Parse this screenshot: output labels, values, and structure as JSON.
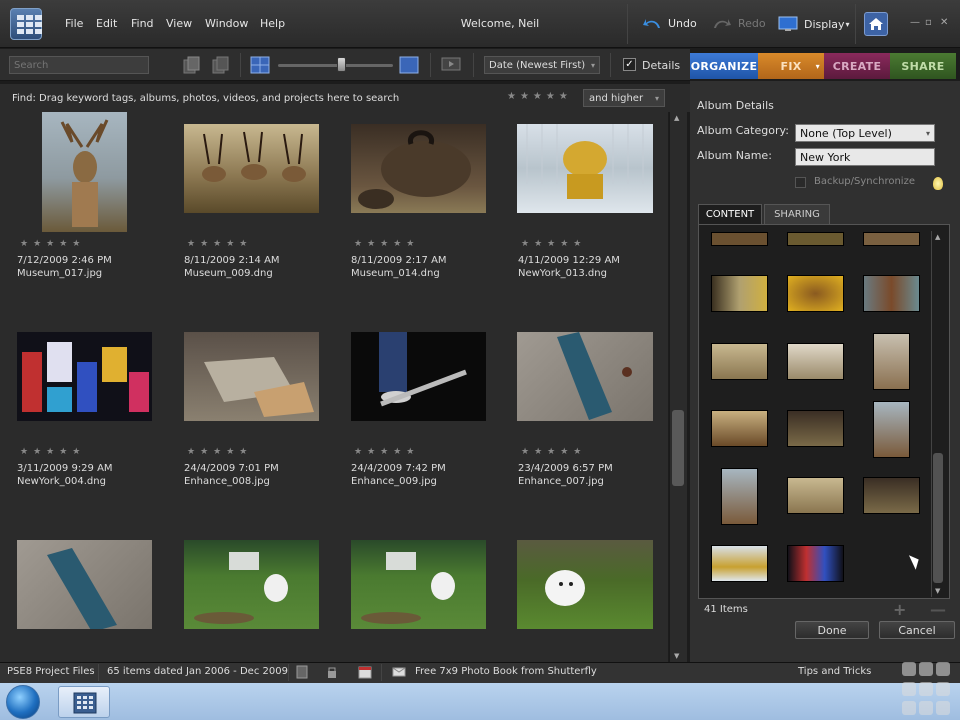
{
  "menubar": {
    "items": [
      "File",
      "Edit",
      "Find",
      "View",
      "Window",
      "Help"
    ],
    "welcome": "Welcome, Neil",
    "undo_label": "Undo",
    "redo_label": "Redo",
    "display_label": "Display",
    "display_arrow": "▾"
  },
  "toolbar": {
    "search_placeholder": "Search",
    "sort_value": "Date (Newest First)",
    "sort_arrow": "▾",
    "details_checked": "✓",
    "details_label": "Details"
  },
  "modes": {
    "organize": "ORGANIZE",
    "fix": "FIX",
    "fix_arrow": "▾",
    "create": "CREATE",
    "share": "SHARE"
  },
  "findbar": {
    "text": "Find: Drag keyword tags, albums, photos, videos, and projects here to search",
    "stars": "★★★★★",
    "rating_value": "and higher",
    "rating_arrow": "▾"
  },
  "photos": [
    {
      "date": "7/12/2009 2:46 PM",
      "name": "Museum_017.jpg",
      "stars": "★★★★★"
    },
    {
      "date": "8/11/2009 2:14 AM",
      "name": "Museum_009.dng",
      "stars": "★★★★★"
    },
    {
      "date": "8/11/2009 2:17 AM",
      "name": "Museum_014.dng",
      "stars": "★★★★★"
    },
    {
      "date": "4/11/2009 12:29 AM",
      "name": "NewYork_013.dng",
      "stars": "★★★★★"
    },
    {
      "date": "3/11/2009 9:29 AM",
      "name": "NewYork_004.dng",
      "stars": "★★★★★"
    },
    {
      "date": "24/4/2009 7:01 PM",
      "name": "Enhance_008.jpg",
      "stars": "★★★★★"
    },
    {
      "date": "24/4/2009 7:42 PM",
      "name": "Enhance_009.jpg",
      "stars": "★★★★★"
    },
    {
      "date": "23/4/2009 6:57 PM",
      "name": "Enhance_007.jpg",
      "stars": "★★★★★"
    },
    {
      "date": "",
      "name": "",
      "stars": ""
    },
    {
      "date": "",
      "name": "",
      "stars": ""
    },
    {
      "date": "",
      "name": "",
      "stars": ""
    },
    {
      "date": "",
      "name": "",
      "stars": ""
    }
  ],
  "panel": {
    "title": "Album Details",
    "category_label": "Album Category:",
    "category_value": "None (Top Level)",
    "category_arrow": "▾",
    "name_label": "Album Name:",
    "name_value": "New York",
    "backup_label": "Backup/Synchronize",
    "tab_content": "CONTENT",
    "tab_sharing": "SHARING",
    "items_count": "41 Items",
    "add_symbol": "+",
    "remove_symbol": "—",
    "done_label": "Done",
    "cancel_label": "Cancel"
  },
  "statusbar": {
    "project": "PSE8 Project Files",
    "dated": "65 items dated Jan 2006 - Dec 2009",
    "promo": "Free 7x9 Photo Book from Shutterfly",
    "tips": "Tips and Tricks"
  },
  "colors": {
    "organize": "#2a62b8",
    "fix": "#c87722",
    "create": "#6e2248",
    "share": "#3c6628",
    "background": "#2b2b2b"
  }
}
